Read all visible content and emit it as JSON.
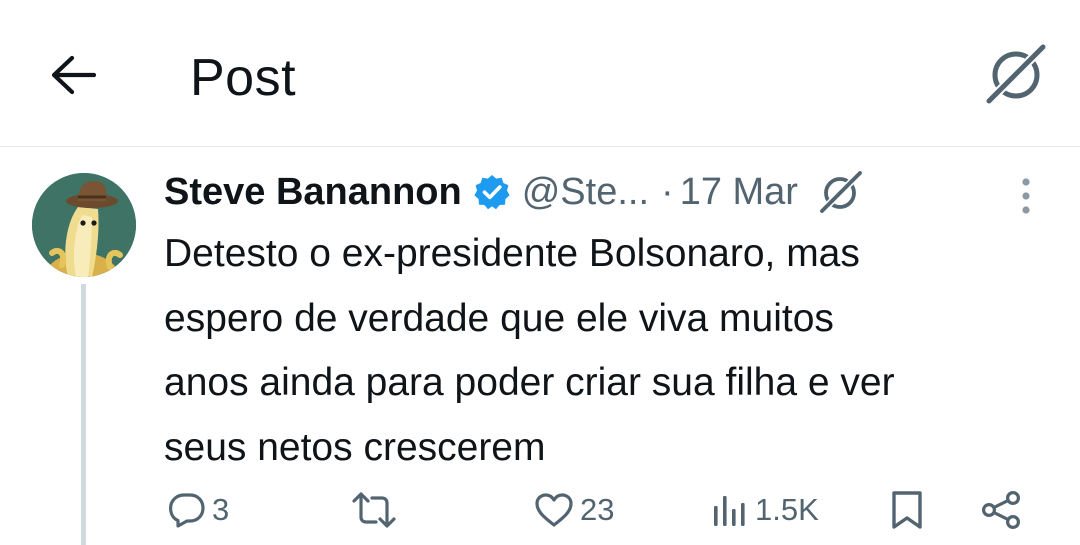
{
  "header": {
    "title": "Post",
    "back_icon": "arrow-left-icon",
    "grok_icon": "grok-icon"
  },
  "post": {
    "author_name": "Steve Banannon",
    "handle": "@Ste...",
    "separator": "·",
    "date": "17 Mar",
    "verified_color": "#1d9bf0",
    "text": "Detesto o ex-presidente Bolsonaro, mas\nespero de verdade que ele viva muitos\nanos ainda para poder criar sua filha e ver\nseus netos crescerem"
  },
  "actions": {
    "replies": "3",
    "reposts": "",
    "likes": "23",
    "views": "1.5K"
  },
  "colors": {
    "text": "#0f1419",
    "muted": "#536471",
    "divider": "#e6e9ec",
    "thread_line": "#cfd9de",
    "accent": "#1d9bf0"
  }
}
